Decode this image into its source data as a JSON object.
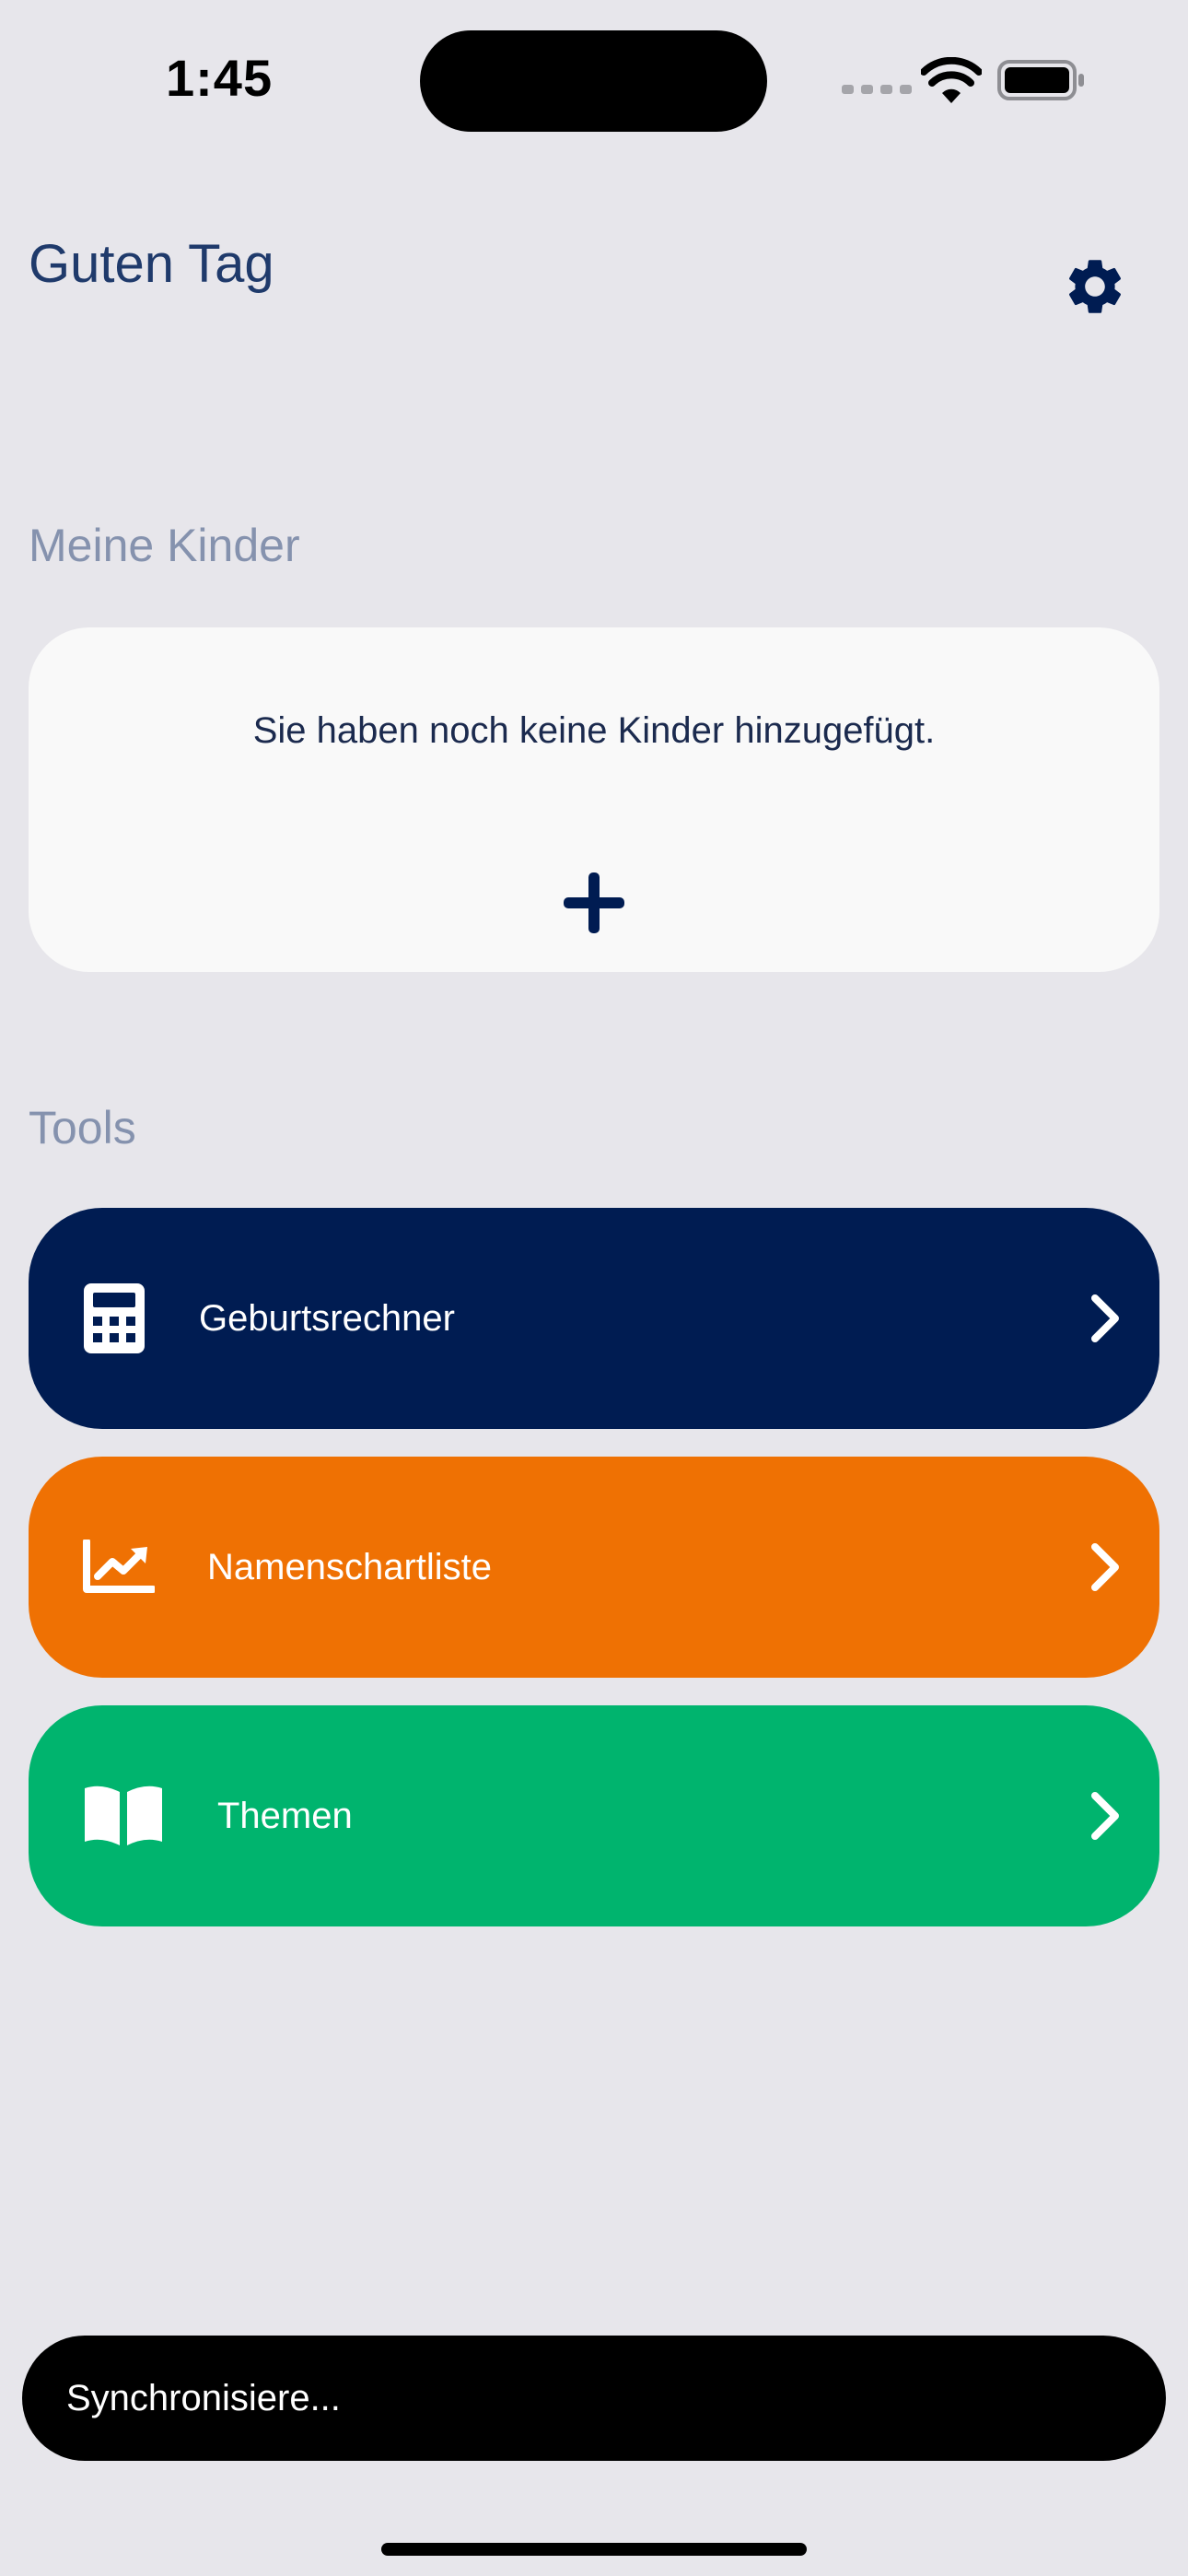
{
  "status_bar": {
    "time": "1:45"
  },
  "header": {
    "title": "Guten Tag",
    "settings_icon": "gear-icon"
  },
  "kids": {
    "section_label": "Meine Kinder",
    "empty_text": "Sie haben noch keine Kinder hinzugefügt.",
    "add_icon": "plus-icon"
  },
  "tools": {
    "section_label": "Tools",
    "items": [
      {
        "label": "Geburtsrechner",
        "icon": "calculator-icon",
        "color": "#001c52"
      },
      {
        "label": "Namenschartliste",
        "icon": "chart-line-icon",
        "color": "#ef7103"
      },
      {
        "label": "Themen",
        "icon": "book-open-icon",
        "color": "#00b46e"
      }
    ]
  },
  "toast": {
    "text": "Synchronisiere..."
  },
  "colors": {
    "background": "#e7e6eb",
    "title": "#1f3a6b",
    "section_label": "#8592ae",
    "navy": "#001c52"
  }
}
